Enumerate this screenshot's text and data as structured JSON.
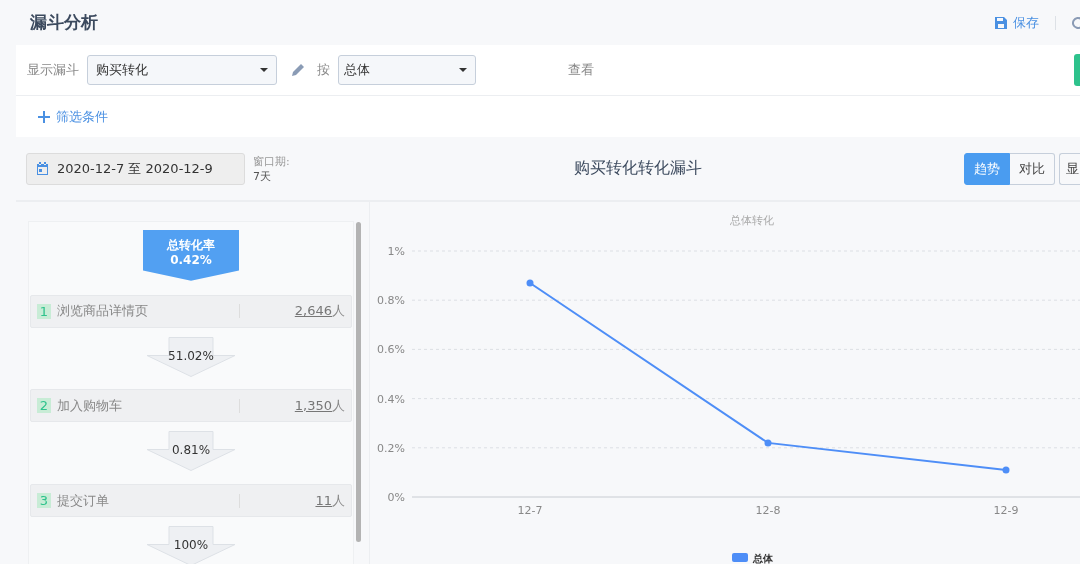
{
  "header": {
    "title": "漏斗分析",
    "save": "保存"
  },
  "filters": {
    "funnel_label": "显示漏斗",
    "funnel_select": "购买转化",
    "by_label": "按",
    "group_select": "总体",
    "view_label": "查看",
    "add_filter": "筛选条件"
  },
  "toolbar": {
    "date_range": "2020-12-7 至 2020-12-9",
    "window_label": "窗口期:",
    "window_value": "7天",
    "title": "购买转化转化漏斗",
    "view_tabs": [
      {
        "label": "趋势",
        "selected": true
      },
      {
        "label": "对比",
        "selected": false
      }
    ],
    "cut_button": "显"
  },
  "funnel": {
    "total_label": "总转化率",
    "total_value": "0.42%",
    "steps": [
      {
        "index": "1",
        "name": "浏览商品详情页",
        "count": "2,646",
        "unit": "人",
        "conversion": "51.02%"
      },
      {
        "index": "2",
        "name": "加入购物车",
        "count": "1,350",
        "unit": "人",
        "conversion": "0.81%"
      },
      {
        "index": "3",
        "name": "提交订单",
        "count": "11",
        "unit": "人",
        "conversion": "100%"
      }
    ]
  },
  "chart": {
    "chart_data": {
      "type": "line",
      "title": "总体转化",
      "grid": true,
      "categories": [
        "12-7",
        "12-8",
        "12-9"
      ],
      "ylim": [
        0,
        1
      ],
      "yticks": [
        {
          "value": 0,
          "label": "0%"
        },
        {
          "value": 0.2,
          "label": "0.2%"
        },
        {
          "value": 0.4,
          "label": "0.4%"
        },
        {
          "value": 0.6,
          "label": "0.6%"
        },
        {
          "value": 0.8,
          "label": "0.8%"
        },
        {
          "value": 1,
          "label": "1%"
        }
      ],
      "series": [
        {
          "name": "总体",
          "color": "#4e8ef7",
          "marker": "circle",
          "values": [
            0.87,
            0.22,
            0.11
          ]
        }
      ]
    }
  }
}
